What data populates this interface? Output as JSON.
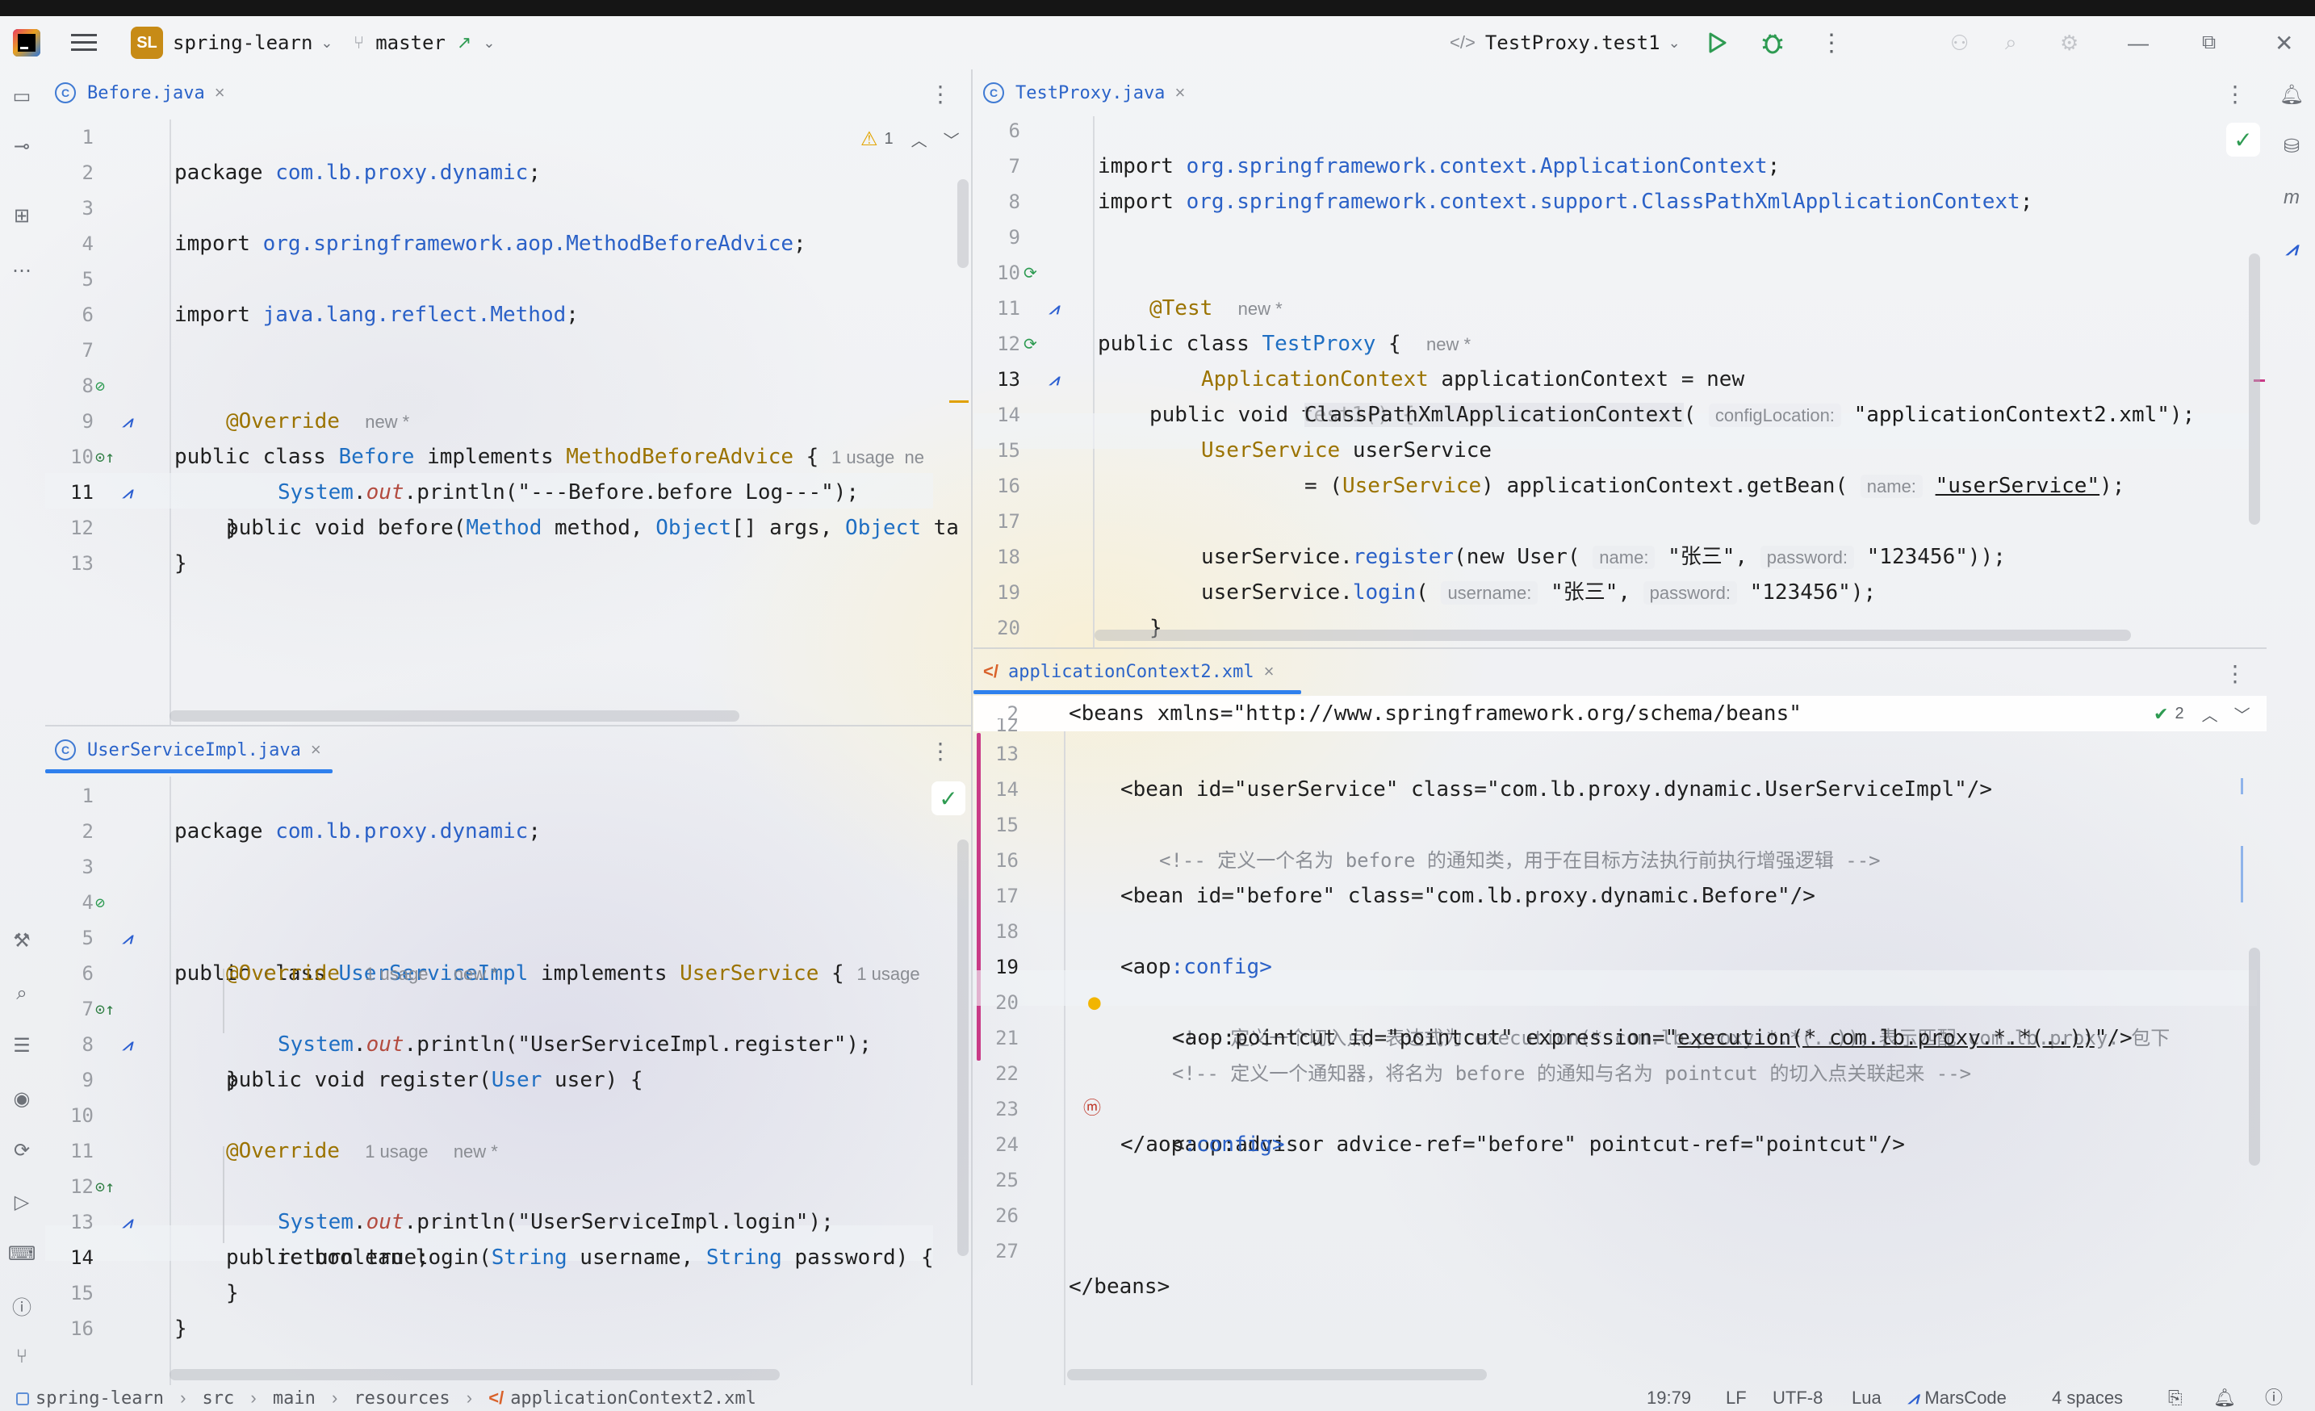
{
  "titlebar": {
    "project_badge": "SL",
    "project_name": "spring-learn",
    "branch": "master",
    "run_config": "TestProxy.test1"
  },
  "panes": {
    "before": {
      "tab": "Before.java",
      "warning_count": "1",
      "lines": [
        {
          "n": "1"
        },
        {
          "n": "2"
        },
        {
          "n": "3"
        },
        {
          "n": "4"
        },
        {
          "n": "5"
        },
        {
          "n": "6"
        },
        {
          "n": "7"
        },
        {
          "n": "8"
        },
        {
          "n": "9"
        },
        {
          "n": "10"
        },
        {
          "n": "11"
        },
        {
          "n": "12"
        },
        {
          "n": "13"
        }
      ],
      "code": {
        "l1_kw": "package ",
        "l1_pkg": "com.lb.proxy.dynamic",
        "l1_end": ";",
        "l3_kw": "import ",
        "l3_pkg": "org.springframework.aop.MethodBeforeAdvice",
        "l3_end": ";",
        "l5_kw": "import ",
        "l5_pkg": "java.lang.reflect.Method",
        "l5_end": ";",
        "l7_a": "public class ",
        "l7_cls": "Before",
        "l7_b": " implements ",
        "l7_iface": "MethodBeforeAdvice",
        "l7_c": " {",
        "l7_hint": "1 usage  ne",
        "l8_ann": "@Override",
        "l8_hint": "new *",
        "l9_a": "public void before(",
        "l9_t1": "Method",
        "l9_b": " method, ",
        "l9_t2": "Object",
        "l9_c": "[] args, ",
        "l9_t3": "Object",
        "l9_d": " ta",
        "l10_cls": "System",
        "l10_dot": ".",
        "l10_out": "out",
        "l10_rest": ".println(\"---Before.before Log---\");",
        "l11": "}",
        "l12": "}"
      }
    },
    "impl": {
      "tab": "UserServiceImpl.java",
      "lines": [
        {
          "n": "1"
        },
        {
          "n": "2"
        },
        {
          "n": "3"
        },
        {
          "n": "4"
        },
        {
          "n": "5"
        },
        {
          "n": "6"
        },
        {
          "n": "7"
        },
        {
          "n": "8"
        },
        {
          "n": "9"
        },
        {
          "n": "10"
        },
        {
          "n": "11"
        },
        {
          "n": "12"
        },
        {
          "n": "13"
        },
        {
          "n": "14"
        },
        {
          "n": "15"
        },
        {
          "n": "16"
        }
      ],
      "code": {
        "l1_kw": "package ",
        "l1_pkg": "com.lb.proxy.dynamic",
        "l1_end": ";",
        "l3_a": "public class ",
        "l3_cls": "UserServiceImpl",
        "l3_b": " implements ",
        "l3_iface": "UserService",
        "l3_c": " {",
        "l3_hint": "1 usage",
        "l5_ann": "@Override",
        "l5_hint1": "1 usage",
        "l5_hint2": "new *",
        "l6_a": "public void register(",
        "l6_t": "User",
        "l6_b": " user) {",
        "l7_cls": "System",
        "l7_dot": ".",
        "l7_out": "out",
        "l7_rest": ".println(\"UserServiceImpl.register\");",
        "l8": "}",
        "l10_ann": "@Override",
        "l10_hint1": "1 usage",
        "l10_hint2": "new *",
        "l11_a": "public boolean login(",
        "l11_t1": "String",
        "l11_b": " username, ",
        "l11_t2": "String",
        "l11_c": " password) {",
        "l12_cls": "System",
        "l12_dot": ".",
        "l12_out": "out",
        "l12_rest": ".println(\"UserServiceImpl.login\");",
        "l13": "return true;",
        "l14": "}",
        "l15": "}"
      }
    },
    "test": {
      "tab": "TestProxy.java",
      "lines": [
        {
          "n": "6"
        },
        {
          "n": "7"
        },
        {
          "n": "8"
        },
        {
          "n": "9"
        },
        {
          "n": "10"
        },
        {
          "n": "11"
        },
        {
          "n": "12"
        },
        {
          "n": "13"
        },
        {
          "n": "14"
        },
        {
          "n": "15"
        },
        {
          "n": "16"
        },
        {
          "n": "17"
        },
        {
          "n": "18"
        },
        {
          "n": "19"
        },
        {
          "n": "20"
        }
      ],
      "code": {
        "l6_kw": "import ",
        "l6_pkg": "org.springframework.context.ApplicationContext",
        "l6_end": ";",
        "l7_kw": "import ",
        "l7_pkg": "org.springframework.context.support.ClassPathXmlApplicationContext",
        "l7_end": ";",
        "l9_a": "public class ",
        "l9_cls": "TestProxy",
        "l9_b": " {",
        "l9_hint": "new *",
        "l10_ann": "@Test",
        "l10_hint": "new *",
        "l11": "public void test1() {",
        "l12_t": "ApplicationContext",
        "l12_rest": " applicationContext = new",
        "l13_cls": "ClassPathXmlApplicationContext",
        "l13_paren": "(",
        "l13_hint": "configLocation:",
        "l13_str": "\"applicationContext2.xml\"",
        "l13_end": ");",
        "l14_t": "UserService",
        "l14_rest": " userService",
        "l15_a": "= (",
        "l15_t": "UserService",
        "l15_b": ") applicationContext.getBean(",
        "l15_hint": "name:",
        "l15_str": "\"userService\"",
        "l15_end": ");",
        "l17_a": "userService.",
        "l17_m": "register",
        "l17_b": "(new User(",
        "l17_h1": "name:",
        "l17_s1": "\"张三\",",
        "l17_h2": "password:",
        "l17_s2": "\"123456\"",
        "l17_end": "));",
        "l18_a": "userService.",
        "l18_m": "login",
        "l18_b": "(",
        "l18_h1": "username:",
        "l18_s1": "\"张三\",",
        "l18_h2": "password:",
        "l18_s2": "\"123456\"",
        "l18_end": ");",
        "l19": "}",
        "l20": "}"
      }
    },
    "xml": {
      "tab": "applicationContext2.xml",
      "sticky_n": "2",
      "sticky": "<beans xmlns=\"http://www.springframework.org/schema/beans\"",
      "check_count": "2",
      "lines": [
        {
          "n": "12"
        },
        {
          "n": "13"
        },
        {
          "n": "14"
        },
        {
          "n": "15"
        },
        {
          "n": "16"
        },
        {
          "n": "17"
        },
        {
          "n": "18"
        },
        {
          "n": "19"
        },
        {
          "n": "20"
        },
        {
          "n": "21"
        },
        {
          "n": "22"
        },
        {
          "n": "23"
        },
        {
          "n": "24"
        },
        {
          "n": "25"
        },
        {
          "n": "26"
        },
        {
          "n": "27"
        }
      ],
      "code": {
        "l13": "<bean id=\"userService\" class=\"com.lb.proxy.dynamic.UserServiceImpl\"/>",
        "l15": "<!-- 定义一个名为 before 的通知类，用于在目标方法执行前执行增强逻辑 -->",
        "l16": "<bean id=\"before\" class=\"com.lb.proxy.dynamic.Before\"/>",
        "l18_a": "<aop",
        "l18_b": ":config>",
        "l19": "<!-- 定义一个切入点，表达式为 execution(* com.lb.proxy.*.*(..))，表示匹配 com.lb.proxy. 包下",
        "l20_a": "<aop",
        "l20_b": ":pointcut id=\"pointcut\" expression=\"",
        "l20_expr": "execution(* com.lb.proxy.*.*(..))",
        "l20_end": "\"/>",
        "l21": "<!-- 定义一个通知器，将名为 before 的通知与名为 pointcut 的切入点关联起来 -->",
        "l22_a": "<aop",
        "l22_b": ":advisor advice-ref=\"before\" pointcut-ref=\"pointcut\"/>",
        "l23_a": "</aop",
        "l23_b": ":config>",
        "l27": "</beans>"
      }
    }
  },
  "statusbar": {
    "crumbs": [
      "spring-learn",
      "src",
      "main",
      "resources",
      "applicationContext2.xml"
    ],
    "position": "19:79",
    "line_sep": "LF",
    "encoding": "UTF-8",
    "lang": "Lua",
    "plugin": "MarsCode",
    "indent": "4 spaces"
  },
  "colors": {
    "accent": "#2f80ed",
    "badge": "#c78b16",
    "run_green": "#2e9b52",
    "xml_bar": "#c93a87"
  }
}
